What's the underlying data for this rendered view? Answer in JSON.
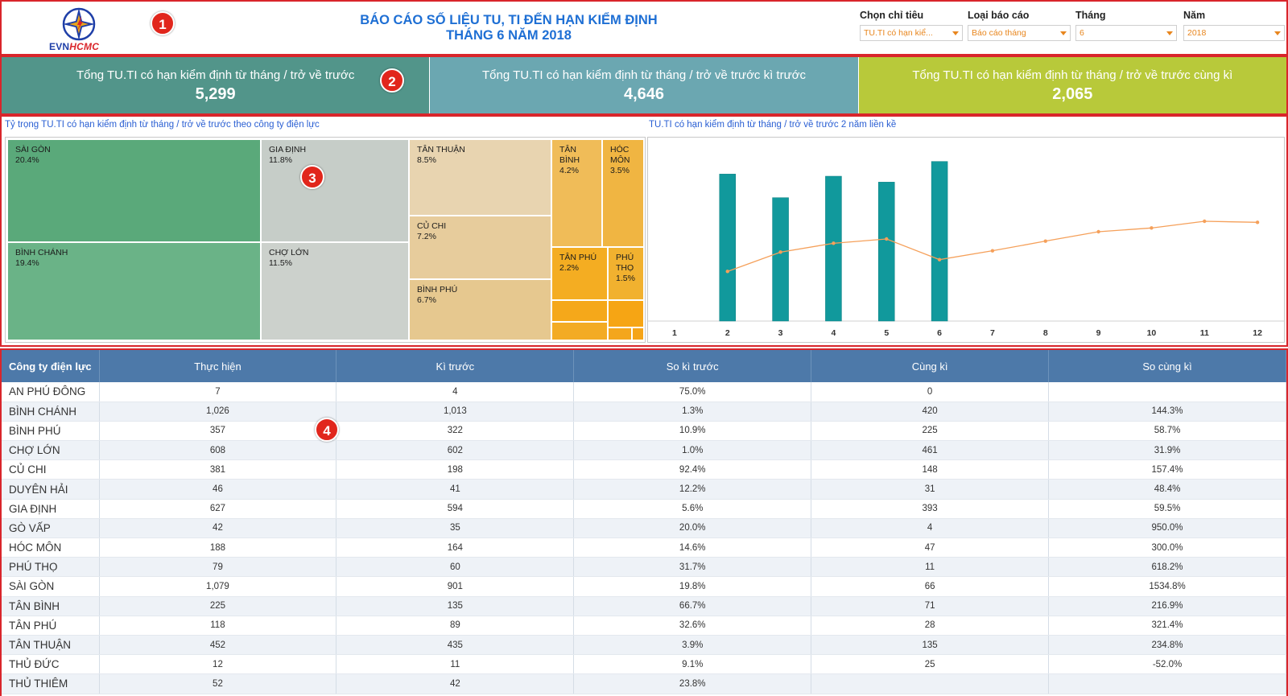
{
  "header": {
    "logo_evn": "EVN",
    "logo_hcmc": "HCMC",
    "title_line1": "BÁO CÁO SỐ LIỆU TU, TI ĐẾN HẠN KIỂM ĐỊNH",
    "title_line2": "THÁNG 6 NĂM 2018",
    "filters": [
      {
        "label": "Chọn chỉ tiêu",
        "value": "TU.TI có hạn kiể..."
      },
      {
        "label": "Loại báo cáo",
        "value": "Báo cáo tháng"
      },
      {
        "label": "Tháng",
        "value": "6"
      },
      {
        "label": "Năm",
        "value": "2018"
      }
    ]
  },
  "badges": [
    "1",
    "2",
    "3",
    "4"
  ],
  "kpis": [
    {
      "label": "Tổng TU.TI có hạn kiểm định từ tháng / trở về trước",
      "value": "5,299",
      "color": "#52958a"
    },
    {
      "label": "Tổng TU.TI có hạn kiểm định từ tháng / trở về trước kì trước",
      "value": "4,646",
      "color": "#6ba7b1"
    },
    {
      "label": "Tổng TU.TI có hạn kiểm định từ tháng / trở về trước cùng kì",
      "value": "2,065",
      "color": "#b8c93a"
    }
  ],
  "treemap": {
    "title": "Tỷ trọng TU.TI có hạn kiểm định từ tháng / trở về trước theo công ty điện lực",
    "tiles": [
      {
        "name": "SÀI GÒN",
        "pct": "20.4%",
        "color": "#5aa97a"
      },
      {
        "name": "BÌNH CHÁNH",
        "pct": "19.4%",
        "color": "#6ab387"
      },
      {
        "name": "GIA ĐỊNH",
        "pct": "11.8%",
        "color": "#c6cdc8"
      },
      {
        "name": "CHỢ LỚN",
        "pct": "11.5%",
        "color": "#ccd1cc"
      },
      {
        "name": "TÂN THUẬN",
        "pct": "8.5%",
        "color": "#e8d4b0"
      },
      {
        "name": "CỦ CHI",
        "pct": "7.2%",
        "color": "#e7cc9c"
      },
      {
        "name": "BÌNH PHÚ",
        "pct": "6.7%",
        "color": "#e6c88f"
      },
      {
        "name": "TÂN BÌNH",
        "pct": "4.2%",
        "color": "#f0bc58"
      },
      {
        "name": "HÓC MÔN",
        "pct": "3.5%",
        "color": "#f0b542"
      },
      {
        "name": "TÂN PHÚ",
        "pct": "2.2%",
        "color": "#f4ad22"
      },
      {
        "name": "PHÚ THỌ",
        "pct": "1.5%",
        "color": "#f1b12f"
      }
    ],
    "minor_colors": [
      "#f5a81a",
      "#f3ab24",
      "#f6a514",
      "#f4a61c",
      "#f5a418"
    ]
  },
  "chart_data": {
    "type": "bar",
    "title": "TU.TI có hạn kiểm định từ tháng / trở về trước 2 năm liền kề",
    "categories": [
      "1",
      "2",
      "3",
      "4",
      "5",
      "6",
      "7",
      "8",
      "9",
      "10",
      "11",
      "12"
    ],
    "series": [
      {
        "type": "bar",
        "color": "#11999c",
        "values": [
          null,
          5480,
          4600,
          5400,
          5180,
          5950,
          null,
          null,
          null,
          null,
          null,
          null
        ]
      },
      {
        "type": "line",
        "color": "#f5a05a",
        "values": [
          null,
          1850,
          2570,
          2900,
          3060,
          2290,
          2620,
          2980,
          3330,
          3470,
          3720,
          3680
        ]
      }
    ],
    "ylim": [
      0,
      6600
    ],
    "grid": false
  },
  "table": {
    "headers": [
      "Công ty điện lực",
      "Thực hiện",
      "Kì trước",
      "So kì trước",
      "Cùng kì",
      "So cùng kì"
    ],
    "rows": [
      [
        "AN PHÚ ĐÔNG",
        "7",
        "4",
        "75.0%",
        "0",
        ""
      ],
      [
        "BÌNH CHÁNH",
        "1,026",
        "1,013",
        "1.3%",
        "420",
        "144.3%"
      ],
      [
        "BÌNH PHÚ",
        "357",
        "322",
        "10.9%",
        "225",
        "58.7%"
      ],
      [
        "CHỢ LỚN",
        "608",
        "602",
        "1.0%",
        "461",
        "31.9%"
      ],
      [
        "CỦ CHI",
        "381",
        "198",
        "92.4%",
        "148",
        "157.4%"
      ],
      [
        "DUYÊN HẢI",
        "46",
        "41",
        "12.2%",
        "31",
        "48.4%"
      ],
      [
        "GIA ĐỊNH",
        "627",
        "594",
        "5.6%",
        "393",
        "59.5%"
      ],
      [
        "GÒ VẤP",
        "42",
        "35",
        "20.0%",
        "4",
        "950.0%"
      ],
      [
        "HÓC MÔN",
        "188",
        "164",
        "14.6%",
        "47",
        "300.0%"
      ],
      [
        "PHÚ THỌ",
        "79",
        "60",
        "31.7%",
        "11",
        "618.2%"
      ],
      [
        "SÀI GÒN",
        "1,079",
        "901",
        "19.8%",
        "66",
        "1534.8%"
      ],
      [
        "TÂN BÌNH",
        "225",
        "135",
        "66.7%",
        "71",
        "216.9%"
      ],
      [
        "TÂN PHÚ",
        "118",
        "89",
        "32.6%",
        "28",
        "321.4%"
      ],
      [
        "TÂN THUẬN",
        "452",
        "435",
        "3.9%",
        "135",
        "234.8%"
      ],
      [
        "THỦ ĐỨC",
        "12",
        "11",
        "9.1%",
        "25",
        "-52.0%"
      ],
      [
        "THỦ THIÊM",
        "52",
        "42",
        "23.8%",
        "",
        ""
      ]
    ]
  }
}
